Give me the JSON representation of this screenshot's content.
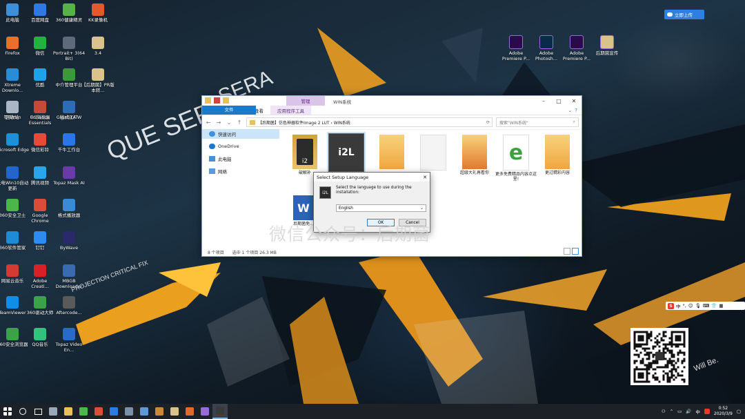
{
  "desktop_icons": [
    {
      "label": "此电脑",
      "icon": "computer-icon",
      "color": "#3c8fd8"
    },
    {
      "label": "百度网盘",
      "icon": "cloud-icon",
      "color": "#2f79e5"
    },
    {
      "label": "360健康精灵",
      "icon": "health-icon",
      "color": "#58b346"
    },
    {
      "label": "KK录像机",
      "icon": "recorder-icon",
      "color": "#e2592c"
    },
    {
      "label": "Firefox",
      "icon": "firefox-icon",
      "color": "#e8702a"
    },
    {
      "label": "微信",
      "icon": "wechat-icon",
      "color": "#23b240"
    },
    {
      "label": "Portrait+ 3(64 Bit)",
      "icon": "portrait-icon",
      "color": "#5e6a7a"
    },
    {
      "label": "3.4",
      "icon": "file-icon",
      "color": "#d9c38a"
    },
    {
      "label": "Xtreme Downlo...",
      "icon": "download-icon",
      "color": "#2a8cd4"
    },
    {
      "label": "优酷",
      "icon": "youku-icon",
      "color": "#1fa3e8"
    },
    {
      "label": "中介管理平台",
      "icon": "platform-icon",
      "color": "#3a9a3a"
    },
    {
      "label": "【后期菌】PR版本转...",
      "icon": "document-icon",
      "color": "#d9c38a"
    },
    {
      "label": "零嗨Win",
      "icon": "app-icon",
      "color": "#3a7bd5"
    },
    {
      "label": "UC浏览器",
      "icon": "uc-browser-icon",
      "color": "#f08a24"
    },
    {
      "label": "搞式工厂",
      "icon": "factory-icon",
      "color": "#8a8a8a"
    },
    {
      "label": "回收站",
      "icon": "recycle-bin-icon",
      "color": "#aab6c6"
    },
    {
      "label": "Enhance Essentials",
      "icon": "app-icon",
      "color": "#c44a3a"
    },
    {
      "label": "GigaBitAIW",
      "icon": "app-icon",
      "color": "#2c6db8"
    },
    {
      "label": "Microsoft Edge",
      "icon": "edge-icon",
      "color": "#1f8fd6"
    },
    {
      "label": "微信彩铃",
      "icon": "music-icon",
      "color": "#e84a3a"
    },
    {
      "label": "千牛工作台",
      "icon": "qianniu-icon",
      "color": "#2a76e8"
    },
    {
      "label": "光电Win10自动更新",
      "icon": "update-icon",
      "color": "#2166c8"
    },
    {
      "label": "腾讯视频",
      "icon": "video-icon",
      "color": "#2aa6e8"
    },
    {
      "label": "Topaz Mask AI",
      "icon": "topaz-icon",
      "color": "#6a3aa8"
    },
    {
      "label": "360安全卫士",
      "icon": "shield-icon",
      "color": "#4cb749"
    },
    {
      "label": "Google Chrome",
      "icon": "chrome-icon",
      "color": "#dd4b39"
    },
    {
      "label": "格式播放器",
      "icon": "player-icon",
      "color": "#3a8ad5"
    },
    {
      "label": "360软件管家",
      "icon": "software-icon",
      "color": "#1f8ad5"
    },
    {
      "label": "钉钉",
      "icon": "dingtalk-icon",
      "color": "#2d8cf0"
    },
    {
      "label": "ByWave",
      "icon": "wave-icon",
      "color": "#2a2a6a"
    },
    {
      "label": "网易云音乐",
      "icon": "netease-music-icon",
      "color": "#d33a31"
    },
    {
      "label": "Adobe Creati...",
      "icon": "adobe-cc-icon",
      "color": "#da1f26"
    },
    {
      "label": "MBGB Downloader",
      "icon": "download-icon",
      "color": "#3a6ab0"
    },
    {
      "label": "TeamViewer",
      "icon": "teamviewer-icon",
      "color": "#0e8ee9"
    },
    {
      "label": "360驱动大师",
      "icon": "driver-icon",
      "color": "#3ba24a"
    },
    {
      "label": "Aftercode...",
      "icon": "app-icon",
      "color": "#5a5a5a"
    },
    {
      "label": "360安全浏览器",
      "icon": "browser-icon",
      "color": "#3ba24a"
    },
    {
      "label": "QQ音乐",
      "icon": "qq-music-icon",
      "color": "#31c27c"
    },
    {
      "label": "Topaz Video En...",
      "icon": "topaz-video-icon",
      "color": "#2a6ac8"
    }
  ],
  "desktop_icons_right": [
    {
      "label": "Adobe Premiere P...",
      "icon": "premiere-icon",
      "color": "#2a0a4a"
    },
    {
      "label": "Adobe Photosh...",
      "icon": "photoshop-icon",
      "color": "#0a2a4a"
    },
    {
      "label": "Adobe Premiere P...",
      "icon": "premiere-icon",
      "color": "#2a0a4a"
    },
    {
      "label": "后期菌宣传",
      "icon": "document-icon",
      "color": "#d9c38a"
    }
  ],
  "wallpaper": {
    "line1": "QUE SERA",
    "line2": "SERA",
    "line3": "PROJECTION CRITICAL FIX",
    "line4": "Will Be."
  },
  "explorer": {
    "manage_tab": "管理",
    "title": "WIN系统",
    "ribbon_tabs": [
      "文件",
      "主页",
      "共享",
      "查看",
      "应用程序工具"
    ],
    "breadcrumb": "【后期菌】仿色神器软件Image 2 LUT  ›  WIN系统",
    "search_placeholder": "搜索\"WIN系统\"",
    "nav": [
      {
        "label": "快速访问",
        "icon": "star-icon"
      },
      {
        "label": "OneDrive",
        "icon": "onedrive-icon"
      },
      {
        "label": "此电脑",
        "icon": "computer-icon"
      },
      {
        "label": "网络",
        "icon": "network-icon"
      }
    ],
    "files": [
      {
        "name": "破解补",
        "kind": "i2l-icon"
      },
      {
        "name": "",
        "kind": "i2l-icon"
      },
      {
        "name": "",
        "kind": "poster-icon"
      },
      {
        "name": "",
        "kind": "blank-icon"
      },
      {
        "name": "超级大礼再看你",
        "kind": "poster-icon"
      },
      {
        "name": "更多免费精品内容点这里!",
        "kind": "ie-icon"
      },
      {
        "name": "更过精彩内容",
        "kind": "poster-icon"
      },
      {
        "name": "后期菌免...",
        "kind": "word-icon"
      }
    ],
    "status": {
      "count": "8 个项目",
      "selected": "选中 1 个项目  26.3 MB"
    }
  },
  "dialog": {
    "title": "Select Setup Language",
    "prompt": "Select the language to use during the installation:",
    "language": "English",
    "ok": "OK",
    "cancel": "Cancel",
    "icon_text": "i2L"
  },
  "watermark": "微信公众号：后期菌",
  "cloud_button": "立即上传",
  "ime": {
    "brand": "S",
    "mode": "中"
  },
  "taskbar": {
    "apps": [
      "start-icon",
      "search-icon",
      "task-view-icon",
      "app-icon",
      "folder-icon",
      "360-icon",
      "chrome-icon",
      "cloud-icon",
      "app-icon",
      "app-icon",
      "app-icon",
      "app-icon",
      "app-icon",
      "premiere-icon",
      "i2l-icon"
    ],
    "time": "0:52",
    "date": "2020/3/9",
    "ime": "中"
  },
  "colors": {
    "accent": "#1979ca",
    "dialog_bg": "#f0f0f0",
    "taskbar": "#1c2128"
  }
}
